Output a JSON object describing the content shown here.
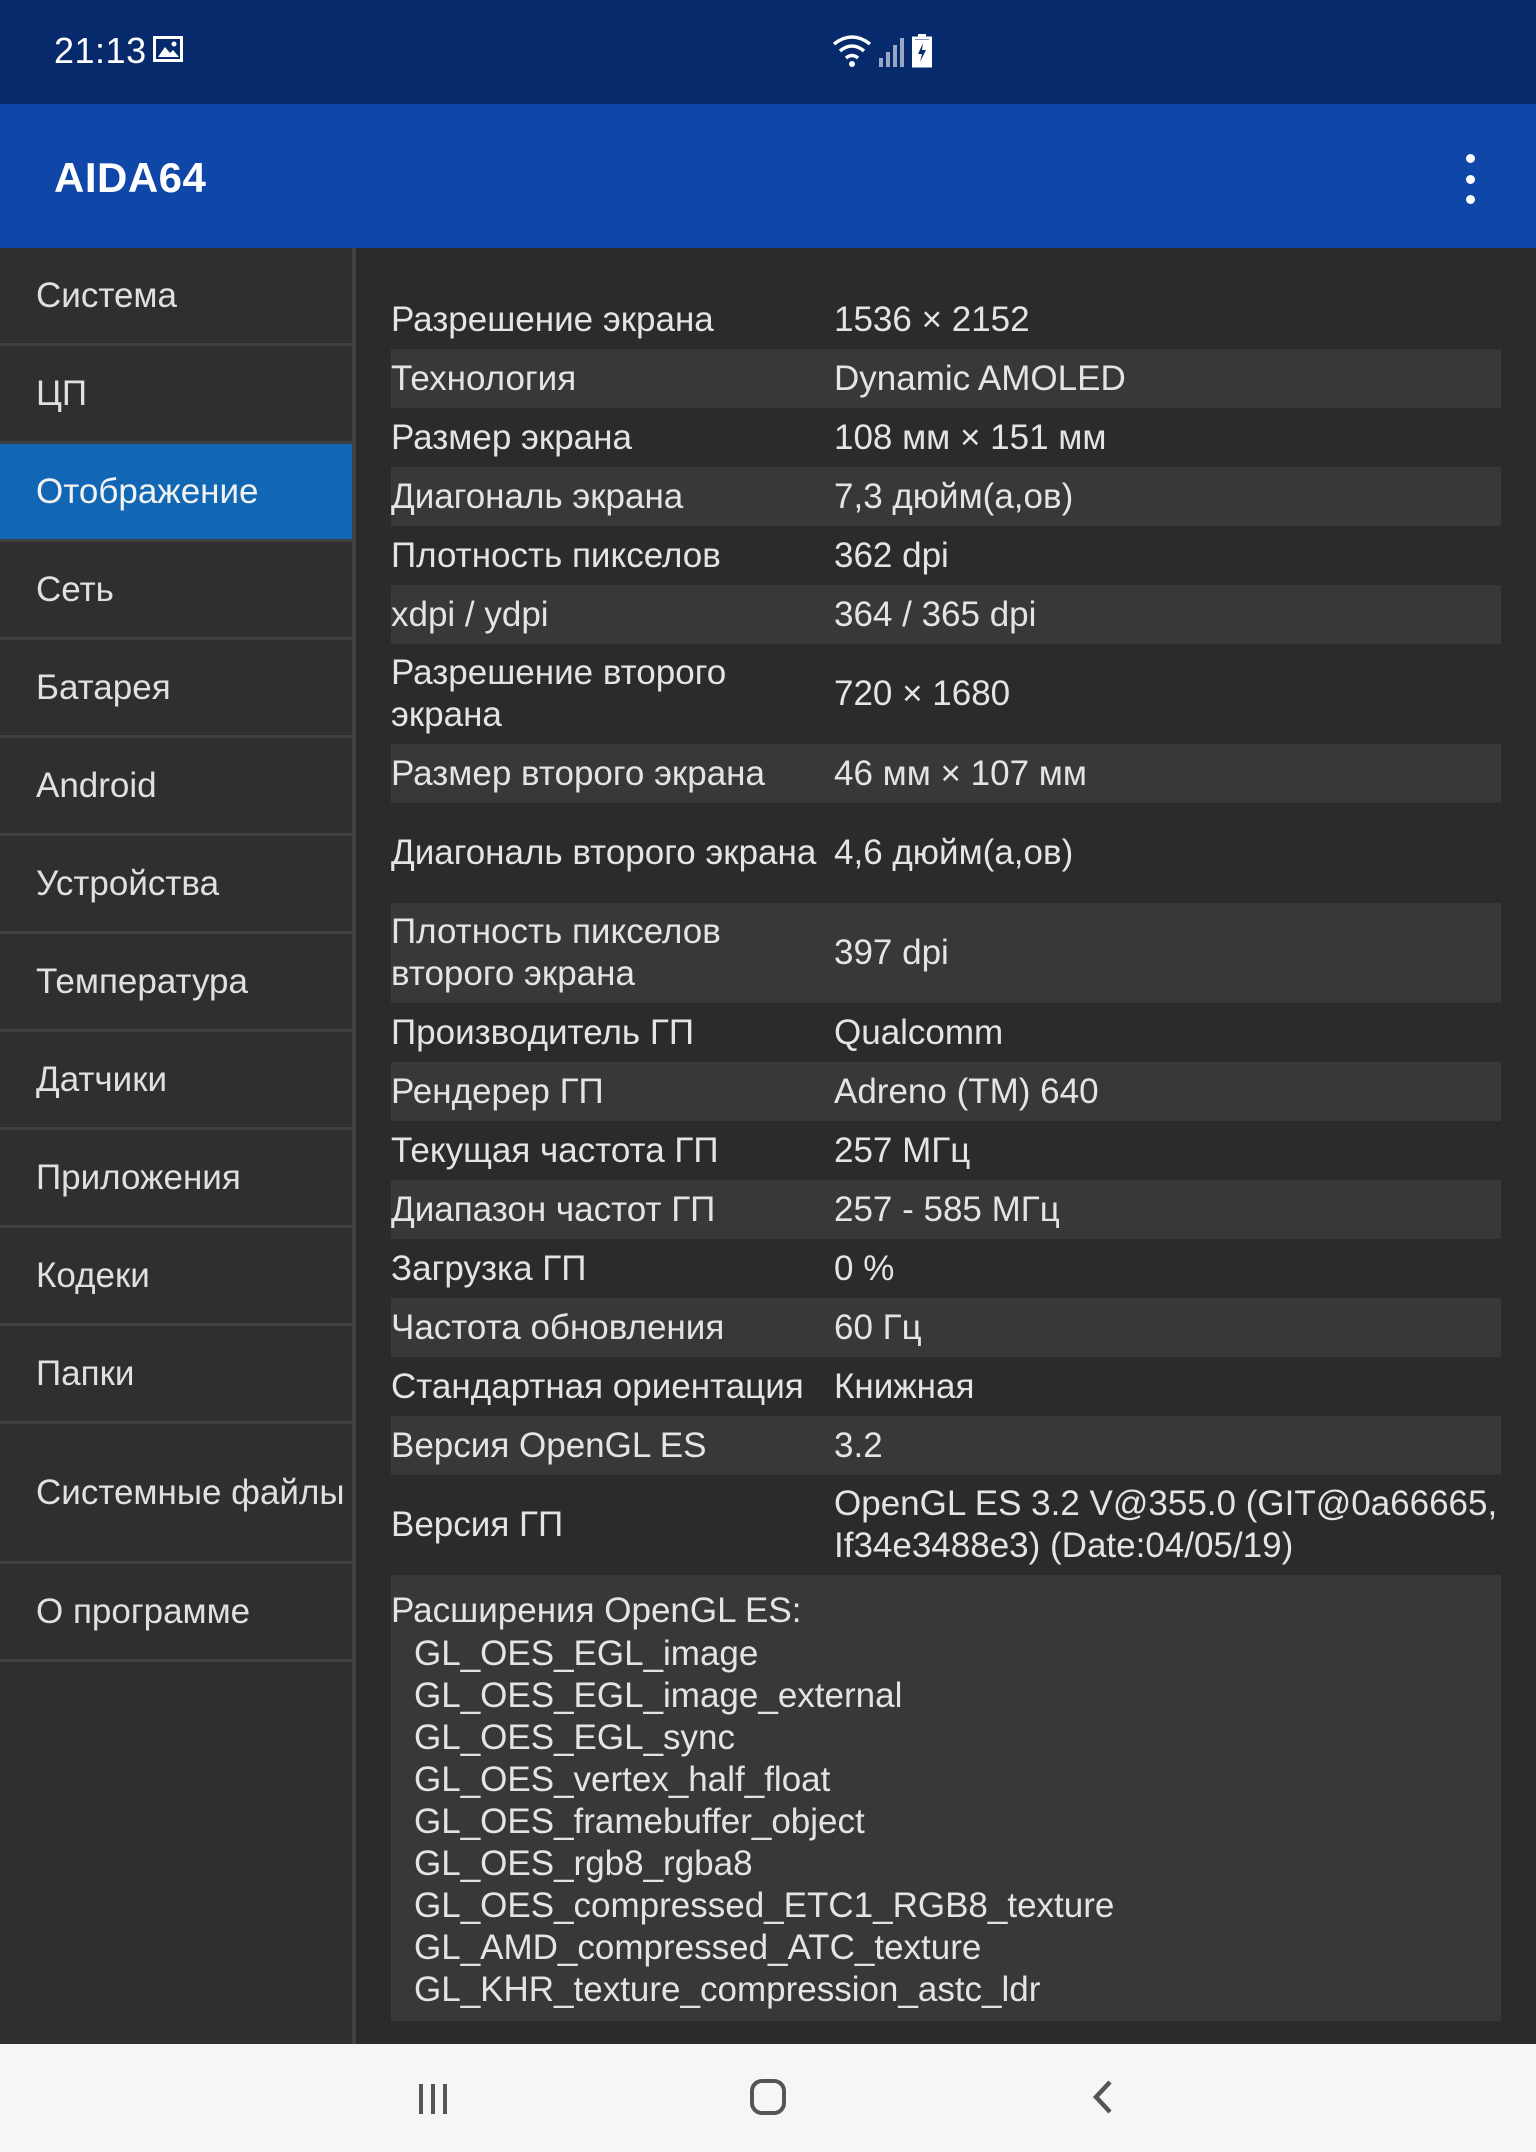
{
  "status_bar": {
    "time": "21:13",
    "icons": [
      "image-icon",
      "wifi-icon",
      "signal-icon",
      "battery-charging-icon"
    ]
  },
  "app_bar": {
    "title": "AIDA64",
    "menu_icon": "more-vert-icon"
  },
  "sidebar": {
    "items": [
      {
        "label": "Система"
      },
      {
        "label": "ЦП"
      },
      {
        "label": "Отображение",
        "active": true
      },
      {
        "label": "Сеть"
      },
      {
        "label": "Батарея"
      },
      {
        "label": "Android"
      },
      {
        "label": "Устройства"
      },
      {
        "label": "Температура"
      },
      {
        "label": "Датчики"
      },
      {
        "label": "Приложения"
      },
      {
        "label": "Кодеки"
      },
      {
        "label": "Папки"
      },
      {
        "label": "Системные файлы"
      },
      {
        "label": "О программе"
      }
    ]
  },
  "details": {
    "rows": [
      {
        "key": "Разрешение экрана",
        "value": "1536 × 2152"
      },
      {
        "key": "Технология",
        "value": "Dynamic AMOLED"
      },
      {
        "key": "Размер экрана",
        "value": "108 мм × 151 мм"
      },
      {
        "key": "Диагональ экрана",
        "value": "7,3 дюйм(а,ов)"
      },
      {
        "key": "Плотность пикселов",
        "value": "362 dpi"
      },
      {
        "key": "xdpi / ydpi",
        "value": "364 / 365 dpi"
      },
      {
        "key": "Разрешение второго экрана",
        "value": "720 × 1680"
      },
      {
        "key": "Размер второго экрана",
        "value": "46 мм × 107 мм"
      },
      {
        "key": "Диагональ второго экрана",
        "value": "4,6 дюйм(а,ов)"
      },
      {
        "key": "Плотность пикселов второго экрана",
        "value": "397 dpi"
      },
      {
        "key": "Производитель ГП",
        "value": "Qualcomm"
      },
      {
        "key": "Рендерер ГП",
        "value": "Adreno (TM) 640"
      },
      {
        "key": "Текущая частота ГП",
        "value": "257 МГц"
      },
      {
        "key": "Диапазон частот ГП",
        "value": "257 - 585 МГц"
      },
      {
        "key": "Загрузка ГП",
        "value": "0 %"
      },
      {
        "key": "Частота обновления",
        "value": "60 Гц"
      },
      {
        "key": "Стандартная ориентация",
        "value": "Книжная"
      },
      {
        "key": "Версия OpenGL ES",
        "value": "3.2"
      },
      {
        "key": "Версия ГП",
        "value": "OpenGL ES 3.2 V@355.0 (GIT@0a66665, If34e3488e3) (Date:04/05/19)"
      }
    ],
    "extensions_title": "Расширения OpenGL ES:",
    "extensions": [
      "GL_OES_EGL_image",
      "GL_OES_EGL_image_external",
      "GL_OES_EGL_sync",
      "GL_OES_vertex_half_float",
      "GL_OES_framebuffer_object",
      "GL_OES_rgb8_rgba8",
      "GL_OES_compressed_ETC1_RGB8_texture",
      "GL_AMD_compressed_ATC_texture",
      "GL_KHR_texture_compression_astc_ldr"
    ]
  },
  "nav_bar": {
    "buttons": [
      "recent-apps-icon",
      "home-icon",
      "back-icon"
    ]
  },
  "colors": {
    "status_bar": "#062a6b",
    "app_bar": "#0f47a8",
    "active_item": "#1167b4",
    "background": "#2b2b2b",
    "alt_row": "#383838"
  }
}
